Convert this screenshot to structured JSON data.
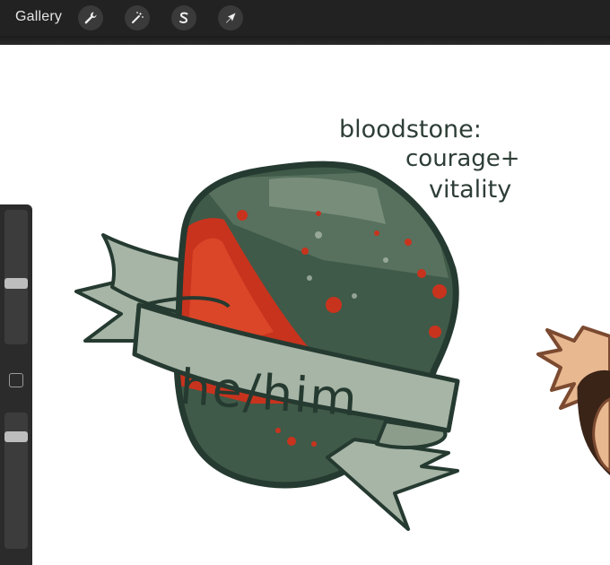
{
  "toolbar": {
    "gallery_label": "Gallery",
    "tools": [
      {
        "name": "wrench-icon",
        "label": "Actions"
      },
      {
        "name": "magic-wand-icon",
        "label": "Adjustments"
      },
      {
        "name": "selection-s-icon",
        "label": "Selection"
      },
      {
        "name": "arrow-cursor-icon",
        "label": "Transform"
      }
    ]
  },
  "sidebar": {
    "brush_size": 0.45,
    "opacity": 0.85
  },
  "artwork": {
    "annotation_lines": [
      "bloodstone:",
      "courage+",
      "vitality"
    ],
    "banner_text": "he/him",
    "colors": {
      "stone_dark": "#3f5a48",
      "stone_mid": "#5c7563",
      "blood_red": "#c8331e",
      "banner_fill": "#a7b5a6",
      "outline": "#253a30",
      "skin": "#e8b890"
    }
  }
}
